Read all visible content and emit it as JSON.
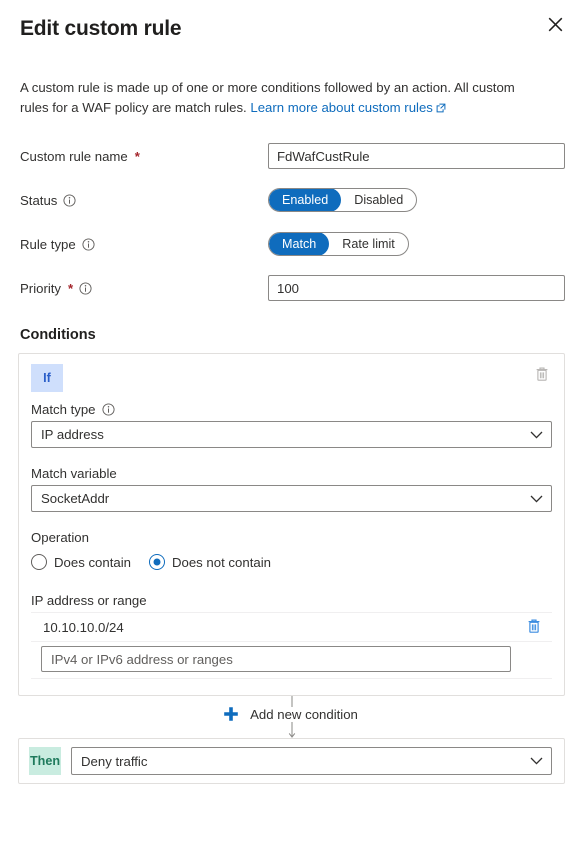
{
  "header": {
    "title": "Edit custom rule",
    "close_icon": "close-icon"
  },
  "intro": {
    "text_before": "A custom rule is made up of one or more conditions followed by an action. All custom rules for a WAF policy are match rules.",
    "link_text": "Learn more about custom rules",
    "link_icon": "external-link-icon"
  },
  "form": {
    "rule_name": {
      "label": "Custom rule name",
      "required_marker": "*",
      "value": "FdWafCustRule"
    },
    "status": {
      "label": "Status",
      "info_icon": "info-icon",
      "options": [
        "Enabled",
        "Disabled"
      ],
      "selected": "Enabled"
    },
    "rule_type": {
      "label": "Rule type",
      "info_icon": "info-icon",
      "options": [
        "Match",
        "Rate limit"
      ],
      "selected": "Match"
    },
    "priority": {
      "label": "Priority",
      "required_marker": "*",
      "info_icon": "info-icon",
      "value": "100"
    }
  },
  "conditions": {
    "section_title": "Conditions",
    "card": {
      "chip": "If",
      "delete_icon": "trash-icon",
      "match_type": {
        "label": "Match type",
        "info_icon": "info-icon",
        "value": "IP address"
      },
      "match_variable": {
        "label": "Match variable",
        "value": "SocketAddr"
      },
      "operation": {
        "label": "Operation",
        "options": [
          "Does contain",
          "Does not contain"
        ],
        "selected": "Does not contain"
      },
      "ip_list": {
        "label": "IP address or range",
        "entries": [
          {
            "value": "10.10.10.0/24",
            "delete_icon": "trash-icon"
          }
        ],
        "new_entry_placeholder": "IPv4 or IPv6 address or ranges",
        "new_entry_value": ""
      }
    },
    "add_condition": {
      "label": "Add new condition",
      "icon": "plus-icon"
    }
  },
  "action": {
    "chip": "Then",
    "value": "Deny traffic",
    "chevron_icon": "chevron-down-icon"
  },
  "colors": {
    "accent_blue": "#0f6cbd",
    "if_chip_bg": "#cfdffc",
    "if_chip_fg": "#2b5fc9",
    "then_chip_bg": "#c9ece0",
    "then_chip_fg": "#1f7a5c",
    "required_red": "#a4262c",
    "border_gray": "#8a8886",
    "card_border": "#e1dfdd"
  }
}
